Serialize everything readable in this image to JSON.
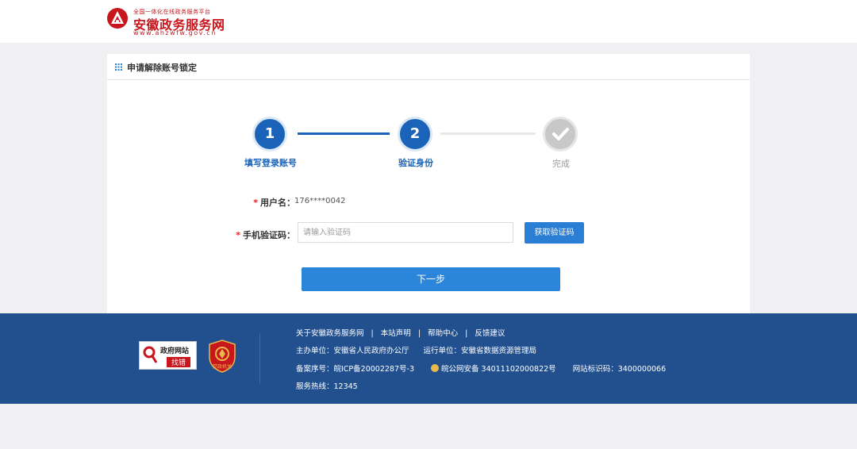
{
  "header": {
    "logo_top": "全国一体化在线政务服务平台",
    "logo_main": "安徽政务服务网",
    "logo_url": "www.ahzwfw.gov.cn"
  },
  "card": {
    "title": "申请解除账号锁定"
  },
  "steps": [
    {
      "number": "1",
      "label": "填写登录账号",
      "state": "active"
    },
    {
      "number": "2",
      "label": "验证身份",
      "state": "active"
    },
    {
      "number": "",
      "label": "完成",
      "state": "pending"
    }
  ],
  "form": {
    "username_label": "用户名：",
    "username_value": "176****0042",
    "code_label": "手机验证码：",
    "code_placeholder": "请输入验证码",
    "code_value": "",
    "get_code_button": "获取验证码",
    "next_button": "下一步",
    "required_mark": "*"
  },
  "footer": {
    "links": [
      "关于安徽政务服务网",
      "本站声明",
      "帮助中心",
      "反馈建议"
    ],
    "link_separator": "|",
    "sponsor": "主办单位：安徽省人民政府办公厅",
    "operator": "运行单位：安徽省数据资源管理局",
    "icp": "备案序号：皖ICP备20002287号-3",
    "police_record": "皖公网安备 34011102000822号",
    "site_id": "网站标识码：3400000066",
    "hotline": "服务热线：12345",
    "badge_gov_line1": "政府网站",
    "badge_gov_line2": "找错",
    "badge_police_text": "党政机关"
  },
  "colors": {
    "primary": "#1a63b8",
    "button": "#2b86d9",
    "footer_bg": "#22508f",
    "logo_red": "#c8161d",
    "required": "#e02020"
  }
}
